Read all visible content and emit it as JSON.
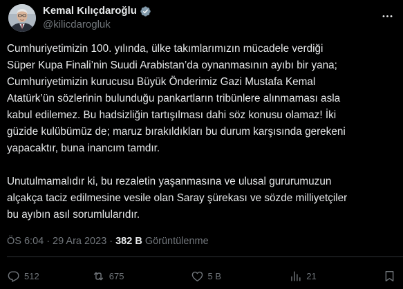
{
  "colors": {
    "background": "#000000",
    "text_primary": "#e7e9ea",
    "text_secondary": "#71767b",
    "verified_badge": "#829aab",
    "divider": "#2f3336"
  },
  "author": {
    "display_name": "Kemal Kılıçdaroğlu",
    "handle": "@kilicdarogluk",
    "verified_icon": "verified-badge-icon",
    "avatar": "profile-photo"
  },
  "tweet": {
    "paragraphs": [
      "Cumhuriyetimizin 100. yılında, ülke takımlarımızın mücadele verdiği\nSüper Kupa Finali’nin Suudi Arabistan’da oynanmasının ayıbı bir yana;\nCumhuriyetimizin kurucusu Büyük Önderimiz Gazi Mustafa Kemal\nAtatürk’ün sözlerinin bulunduğu pankartların tribünlere alınmaması asla\nkabul edilemez. Bu hadsizliğin tartışılması dahi söz konusu olamaz! İki\ngüzide kulübümüz de; maruz bırakıldıkları bu durum karşısında gerekeni\nyapacaktır, buna inancım tamdır.",
      "Unutulmamalıdır ki, bu rezaletin yaşanmasına ve ulusal gururumuzun\nalçakça taciz edilmesine vesile olan Saray şürekası ve sözde milliyetçiler\nbu ayıbın asıl sorumlularıdır."
    ]
  },
  "meta": {
    "time": "ÖS 6:04",
    "separator": "·",
    "date": "29 Ara 2023",
    "views_count": "382 B",
    "views_label": "Görüntülenme"
  },
  "actions": {
    "reply_count": "512",
    "retweet_count": "675",
    "like_count": "5 B",
    "views_count": "21"
  },
  "icons": {
    "more": "more-options-icon",
    "reply": "reply-icon",
    "retweet": "retweet-icon",
    "like": "heart-icon",
    "views": "views-bar-chart-icon",
    "bookmark": "bookmark-icon"
  }
}
